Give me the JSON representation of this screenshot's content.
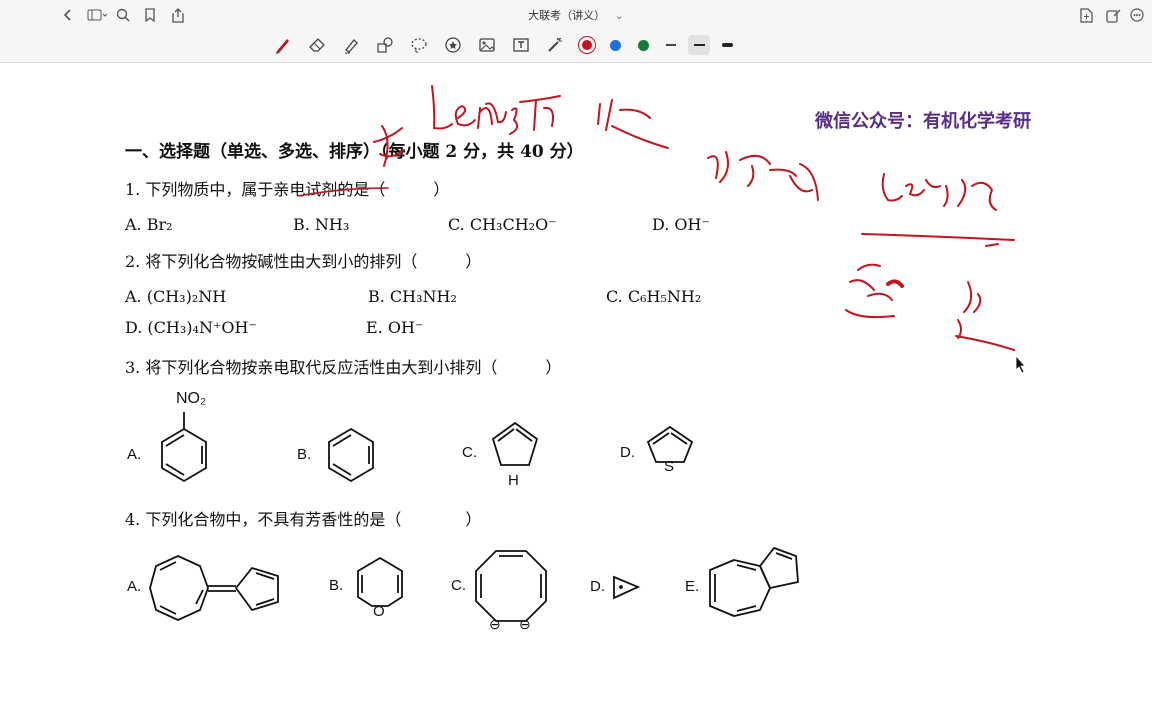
{
  "window": {
    "title": "大联考（讲义）",
    "title_chevron": "⌄"
  },
  "toolbar": {
    "tools": [
      "pen-tool",
      "eraser-tool",
      "highlighter-tool",
      "shapes-tool",
      "lasso-tool",
      "sticker-tool",
      "image-tool",
      "text-tool",
      "laser-pointer-tool"
    ],
    "colors": [
      "#c0161d",
      "#1f6fd6",
      "#137a3a"
    ],
    "stroke_sizes": [
      "thin",
      "medium",
      "thick"
    ]
  },
  "document": {
    "watermark": "微信公众号：有机化学考研",
    "section_heading": "一、选择题（单选、多选、排序）（每小题 2 分，共 40 分）",
    "q1": {
      "text": "1. 下列物质中，属于亲电试剂的是（　　　）",
      "options": [
        "A. Br₂",
        "B. NH₃",
        "C. CH₃CH₂O⁻",
        "D. OH⁻"
      ]
    },
    "q2": {
      "text": "2. 将下列化合物按碱性由大到小的排列（　　　）",
      "options": [
        "A. (CH₃)₂NH",
        "B. CH₃NH₂",
        "C. C₆H₅NH₂",
        "D. (CH₃)₄N⁺OH⁻",
        "E. OH⁻"
      ]
    },
    "q3": {
      "text": "3. 将下列化合物按亲电取代反应活性由大到小排列（　　　）",
      "labels": [
        "A.",
        "B.",
        "C.",
        "D."
      ],
      "nitro_label": "NO₂",
      "pyrrole_label": "H",
      "thiophene_label": "S"
    },
    "q4": {
      "text": "4. 下列化合物中，不具有芳香性的是（　　　　）",
      "labels": [
        "A.",
        "B.",
        "C.",
        "D.",
        "E."
      ],
      "pyran_label": "O",
      "anion_label": "⊖"
    }
  }
}
